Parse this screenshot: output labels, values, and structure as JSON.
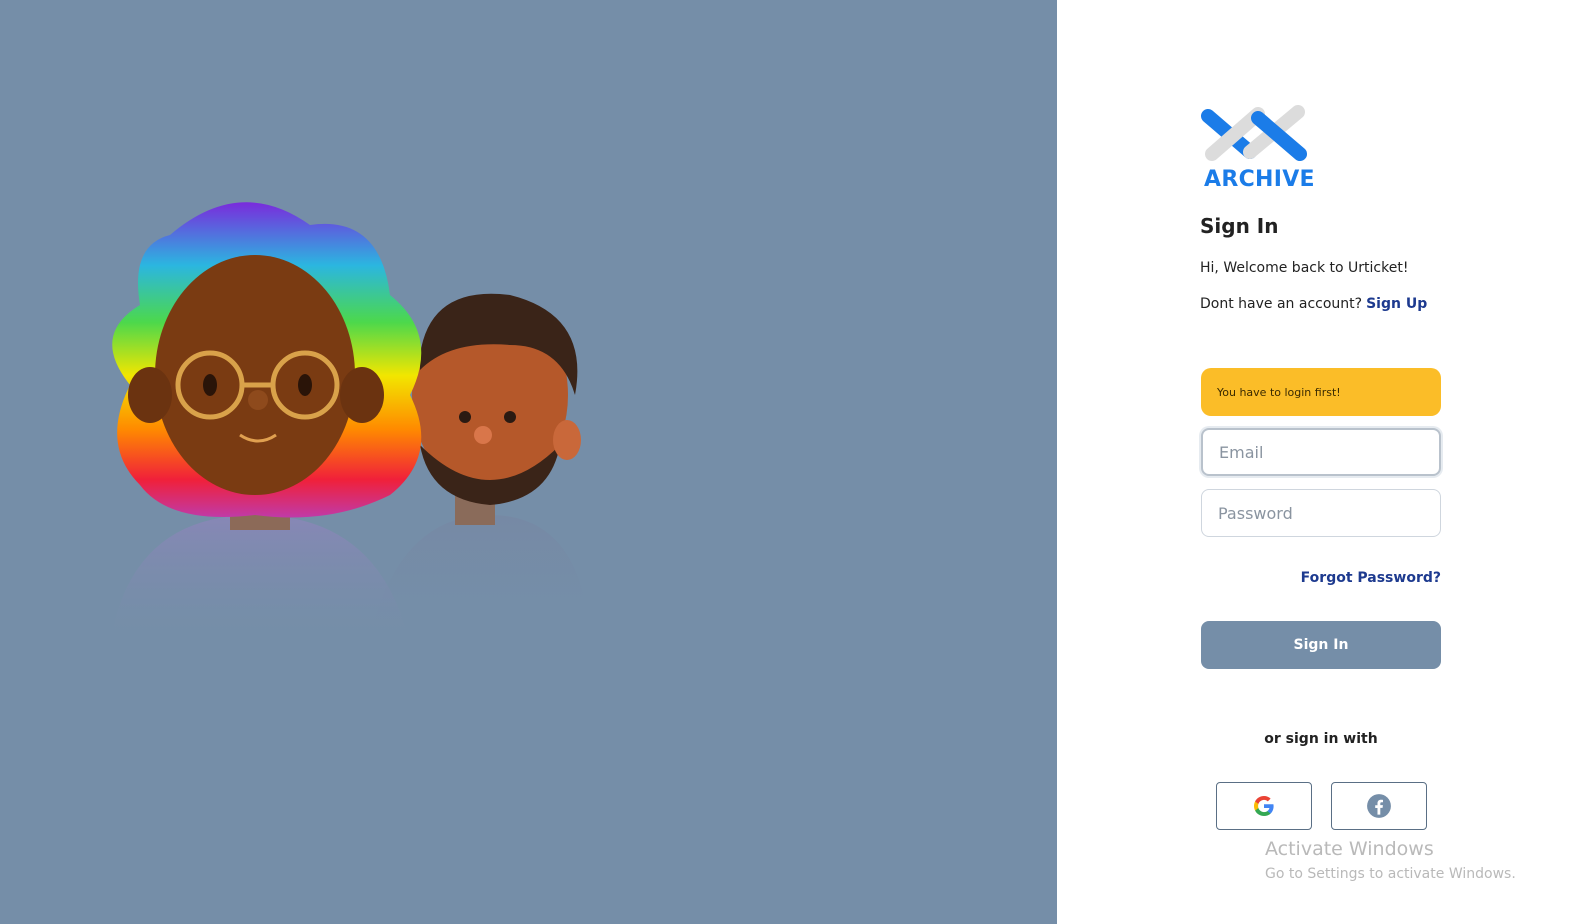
{
  "brand": {
    "name": "ARCHIVE",
    "color": "#1b7ce8"
  },
  "auth": {
    "title": "Sign In",
    "welcome": "Hi, Welcome back to Urticket!",
    "no_account_text": "Dont have an account?",
    "signup_link": "Sign Up",
    "alert": "You have to login first!",
    "email_placeholder": "Email",
    "password_placeholder": "Password",
    "forgot": "Forgot Password?",
    "submit": "Sign In",
    "or_text": "or sign in with"
  },
  "social": [
    {
      "name": "google-icon"
    },
    {
      "name": "facebook-icon"
    }
  ],
  "watermark": {
    "title": "Activate Windows",
    "subtitle": "Go to Settings to activate Windows."
  },
  "colors": {
    "panel": "#758ea8",
    "alert": "#fbbd28",
    "link": "#1d3a8f",
    "button": "#758ea8"
  }
}
